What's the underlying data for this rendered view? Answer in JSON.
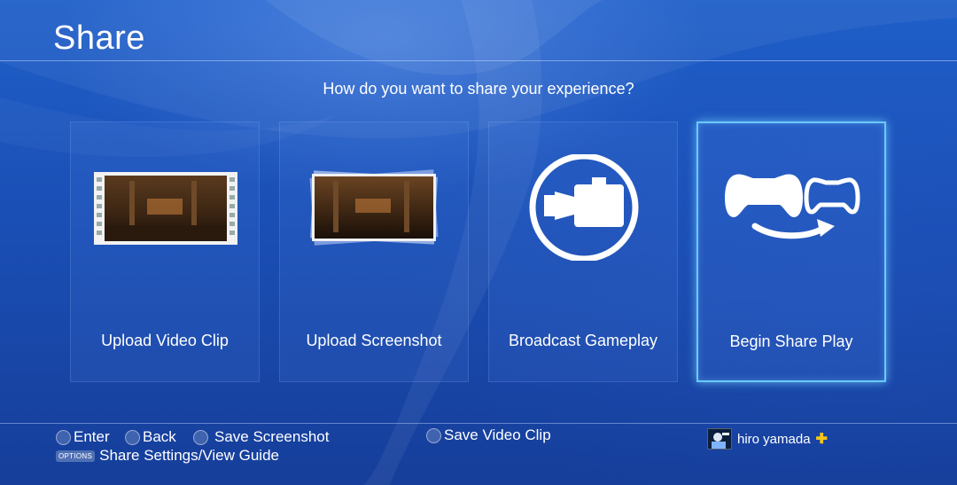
{
  "header": {
    "title": "Share"
  },
  "prompt": "How do you want to share your experience?",
  "tiles": [
    {
      "label": "Upload Video Clip",
      "icon": "film-strip-icon"
    },
    {
      "label": "Upload Screenshot",
      "icon": "screenshot-stack-icon"
    },
    {
      "label": "Broadcast Gameplay",
      "icon": "video-camera-icon"
    },
    {
      "label": "Begin Share Play",
      "icon": "share-play-controllers-icon",
      "selected": true
    }
  ],
  "footer": {
    "enter": "Enter",
    "back": "Back",
    "save_screenshot": "Save Screenshot",
    "save_video_clip": "Save Video Clip",
    "options_badge": "OPTIONS",
    "share_settings": "Share Settings/View Guide"
  },
  "user": {
    "name": "hiro yamada",
    "plus_badge": "✚"
  },
  "colors": {
    "accent": "#69c9ff",
    "background": "#1a4fb5",
    "plus": "#f5c518"
  }
}
